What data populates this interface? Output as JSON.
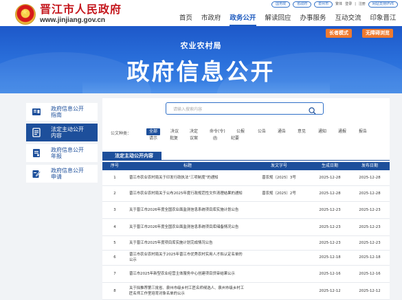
{
  "header": {
    "site_title": "晋江市人民政府",
    "site_url": "www.jinjiang.gov.cn",
    "top_pills": [
      "国务院",
      "省政府",
      "泉州市"
    ],
    "top_links": [
      "繁体",
      "登录",
      "注册"
    ],
    "top_last_pill": "网站支持IPV6"
  },
  "nav": [
    "首页",
    "市政府",
    "政务公开",
    "解读回应",
    "办事服务",
    "互动交流",
    "印象晋江"
  ],
  "nav_active": "政务公开",
  "banner": {
    "bureau": "农业农村局",
    "title": "政府信息公开",
    "elder_mode": "长者模式",
    "accessible": "无障碍浏览"
  },
  "sidebar": [
    {
      "label": "政府信息公开指南",
      "icon": "book-icon",
      "active": false
    },
    {
      "label": "法定主动公开内容",
      "icon": "list-icon",
      "active": true
    },
    {
      "label": "政府信息公开年报",
      "icon": "report-icon",
      "active": false
    },
    {
      "label": "政府信息公开申请",
      "icon": "edit-icon",
      "active": false
    }
  ],
  "search": {
    "placeholder": "请输入搜索内容"
  },
  "filter": {
    "label": "公文种类：",
    "row1": [
      "全部",
      "决议",
      "决定",
      "命令(令)",
      "公报",
      "公告",
      "通告",
      "意见",
      "通知",
      "通报",
      "报告"
    ],
    "row2": [
      "请示",
      "批复",
      "议案",
      "函",
      "纪要"
    ],
    "active": "全部"
  },
  "section_tab": "法定主动公开内容",
  "table": {
    "headers": [
      "序号",
      "标题",
      "发文字号",
      "生成日期",
      "发布日期"
    ],
    "rows": [
      {
        "no": "1",
        "title": "晋江市农业农村局关于印发行政执法“三项制度”的通知",
        "doc_no": "晋农规〔2025〕3号",
        "created": "2025-12-28",
        "published": "2025-12-28"
      },
      {
        "no": "2",
        "title": "晋江市农业农村局关于公布2025年度行政规范性文件清理结果的通知",
        "doc_no": "晋农规〔2025〕2号",
        "created": "2025-12-28",
        "published": "2025-12-28"
      },
      {
        "no": "3",
        "title": "关于晋江市2026年度全国农业面监测信息系统项目库实施计划公告",
        "doc_no": "",
        "created": "2025-12-23",
        "published": "2025-12-23"
      },
      {
        "no": "4",
        "title": "关于晋江市2026年度全国农业面监测信息系统项目库储备情况公告",
        "doc_no": "",
        "created": "2025-12-23",
        "published": "2025-12-23"
      },
      {
        "no": "5",
        "title": "关于晋江市2025年度项目库实施计划完成情况公告",
        "doc_no": "",
        "created": "2025-12-23",
        "published": "2025-12-23"
      },
      {
        "no": "6",
        "title": "晋江市农业农村局关于2025年晋江市优秀农村实用人才拟认定名单的公示",
        "doc_no": "",
        "created": "2025-12-18",
        "published": "2025-12-18"
      },
      {
        "no": "7",
        "title": "晋江市2025年新型农业经营主体服务中心创建项目贷审结果公示",
        "doc_no": "",
        "created": "2025-12-16",
        "published": "2025-12-16"
      },
      {
        "no": "8",
        "title": "关于拟推荐第三批省、泉州市级乡村工匠名师候选人、泉州市级乡村工匠名师工作室培育对象名单的公示",
        "doc_no": "",
        "created": "2025-12-12",
        "published": "2025-12-12"
      }
    ]
  },
  "colors": {
    "primary": "#1d4f9b",
    "accent": "#2f6fc7",
    "brand_red": "#c4161c",
    "orange": "#f07a2e"
  }
}
